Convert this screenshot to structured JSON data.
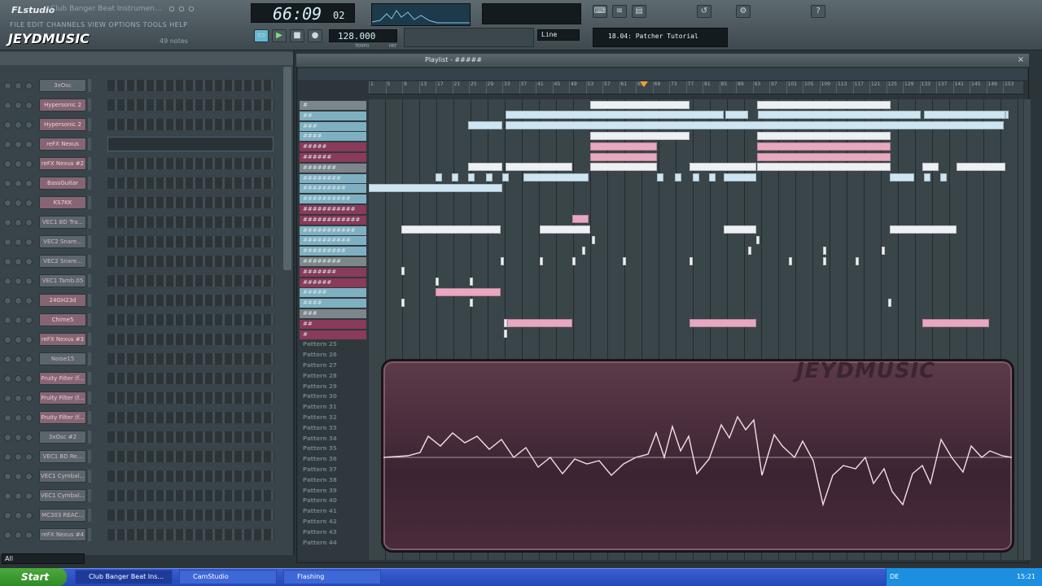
{
  "app": {
    "logo": "FLstudio",
    "window_title": "Club Banger Beat Instrumen...",
    "menus": [
      "FILE",
      "EDIT",
      "CHANNELS",
      "VIEW",
      "OPTIONS",
      "TOOLS",
      "HELP"
    ],
    "hint": "49 notes",
    "watermark": "JEYDMUSIC",
    "shortcut_logo": "JEYDMUSIC"
  },
  "transport": {
    "time": "66:09",
    "time_small": "02",
    "tempo": "128.000",
    "tempo_label": "TEMPO",
    "pattern_hint": "PAT",
    "song_title": "18.04: Patcher Tutorial",
    "snap": "Line"
  },
  "channels": [
    {
      "name": "3xOsc",
      "pink": false
    },
    {
      "name": "Hypersonic 2",
      "pink": true
    },
    {
      "name": "Hypersonic 2",
      "pink": true
    },
    {
      "name": "reFX Nexus",
      "pink": true
    },
    {
      "name": "reFX Nexus #2",
      "pink": true
    },
    {
      "name": "BassGuitar",
      "pink": true
    },
    {
      "name": "KS7KK",
      "pink": true
    },
    {
      "name": "VEC1 BD Tra...",
      "pink": false
    },
    {
      "name": "VEC2 Snare...",
      "pink": false
    },
    {
      "name": "VEC2 Snare...",
      "pink": false
    },
    {
      "name": "VEC1 Tamb.05",
      "pink": false
    },
    {
      "name": "24GH23d",
      "pink": true
    },
    {
      "name": "Chime5",
      "pink": true
    },
    {
      "name": "reFX Nexus #3",
      "pink": true
    },
    {
      "name": "Noise15",
      "pink": false
    },
    {
      "name": "Fruity Filter (f...",
      "pink": true
    },
    {
      "name": "Fruity Filter (f...",
      "pink": true
    },
    {
      "name": "Fruity Filter (f...",
      "pink": true
    },
    {
      "name": "3xOsc #2",
      "pink": false
    },
    {
      "name": "VEC1 BD Re...",
      "pink": false
    },
    {
      "name": "VEC1 Cymbal...",
      "pink": false
    },
    {
      "name": "VEC1 Cymbal...",
      "pink": false
    },
    {
      "name": "MC303 REAC...",
      "pink": false
    },
    {
      "name": "reFX Nexus #4",
      "pink": false
    }
  ],
  "channel_filter": "All",
  "playlist": {
    "title": "Playlist - #####",
    "patterns": [
      {
        "label": "#",
        "style": "gray"
      },
      {
        "label": "##",
        "style": "cyan"
      },
      {
        "label": "###",
        "style": "cyan"
      },
      {
        "label": "####",
        "style": "cyan"
      },
      {
        "label": "#####",
        "style": "pink"
      },
      {
        "label": "######",
        "style": "pink"
      },
      {
        "label": "#######",
        "style": "gray"
      },
      {
        "label": "########",
        "style": "cyan"
      },
      {
        "label": "#########",
        "style": "cyan"
      },
      {
        "label": "##########",
        "style": "cyan"
      },
      {
        "label": "###########",
        "style": "pink"
      },
      {
        "label": "############",
        "style": "pink"
      },
      {
        "label": "###########",
        "style": "cyan"
      },
      {
        "label": "##########",
        "style": "cyan"
      },
      {
        "label": "#########",
        "style": "cyan"
      },
      {
        "label": "########",
        "style": "gray"
      },
      {
        "label": "#######",
        "style": "pink"
      },
      {
        "label": "######",
        "style": "pink"
      },
      {
        "label": "#####",
        "style": "cyan"
      },
      {
        "label": "####",
        "style": "cyan"
      },
      {
        "label": "###",
        "style": "gray"
      },
      {
        "label": "##",
        "style": "pink"
      },
      {
        "label": "#",
        "style": "pink"
      },
      {
        "label": "Pattern 25",
        "style": "empty"
      },
      {
        "label": "Pattern 26",
        "style": "empty"
      },
      {
        "label": "Pattern 27",
        "style": "empty"
      },
      {
        "label": "Pattern 28",
        "style": "empty"
      },
      {
        "label": "Pattern 29",
        "style": "empty"
      },
      {
        "label": "Pattern 30",
        "style": "empty"
      },
      {
        "label": "Pattern 31",
        "style": "empty"
      },
      {
        "label": "Pattern 32",
        "style": "empty"
      },
      {
        "label": "Pattern 33",
        "style": "empty"
      },
      {
        "label": "Pattern 34",
        "style": "empty"
      },
      {
        "label": "Pattern 35",
        "style": "empty"
      },
      {
        "label": "Pattern 36",
        "style": "empty"
      },
      {
        "label": "Pattern 37",
        "style": "empty"
      },
      {
        "label": "Pattern 38",
        "style": "empty"
      },
      {
        "label": "Pattern 39",
        "style": "empty"
      },
      {
        "label": "Pattern 40",
        "style": "empty"
      },
      {
        "label": "Pattern 41",
        "style": "empty"
      },
      {
        "label": "Pattern 42",
        "style": "empty"
      },
      {
        "label": "Pattern 43",
        "style": "empty"
      },
      {
        "label": "Pattern 44",
        "style": "empty"
      }
    ],
    "ruler": [
      "1",
      "5",
      "9",
      "13",
      "17",
      "21",
      "25",
      "29",
      "33",
      "37",
      "41",
      "45",
      "49",
      "53",
      "57",
      "61",
      "65",
      "69",
      "73",
      "77",
      "81",
      "85",
      "89",
      "93",
      "97",
      "101",
      "105",
      "109",
      "113",
      "117",
      "121",
      "125",
      "129",
      "133",
      "137",
      "141",
      "145",
      "149",
      "153"
    ]
  },
  "viz_brand": "JEYDMUSIC",
  "taskbar": {
    "start": "Start",
    "tasks": [
      "Club Banger Beat Ins...",
      "CamStudio",
      "Flashing"
    ],
    "lang": "DE",
    "clock": "15:21"
  }
}
